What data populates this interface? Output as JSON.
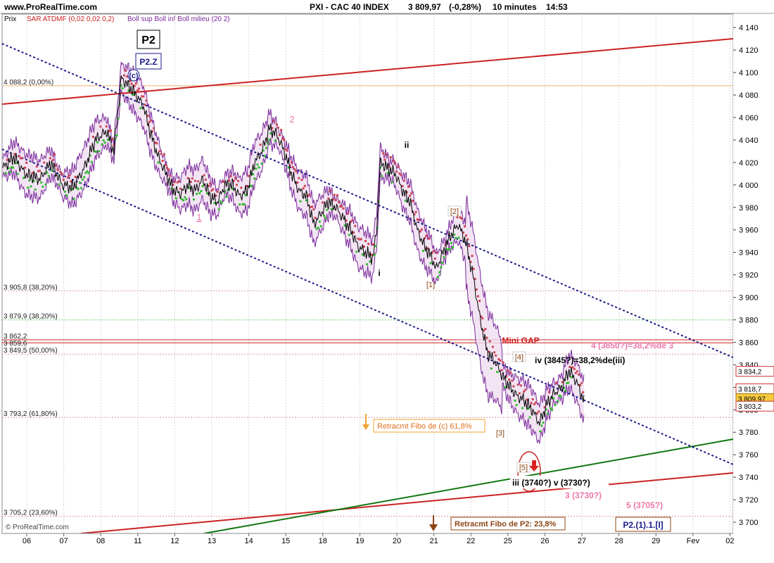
{
  "header": {
    "site": "www.ProRealTime.com",
    "title": "PXI - CAC 40 INDEX",
    "price": "3 809,97",
    "change": "(-0,28%)",
    "interval": "10 minutes",
    "time": "14:53"
  },
  "legend": {
    "prix": "Prix",
    "sar": "SAR ATDMF (0,02 0,02 0,2)",
    "boll": "Boll sup Boll inf Boll milieu (20 2)"
  },
  "watermark": "© ProRealTime.com",
  "colors": {
    "price": "#000000",
    "sar_up": "#33bb33",
    "sar_down": "#cc4455",
    "boll": "#7a2a9a",
    "boll_fill": "#f0ddf0",
    "trend_red": "#cc2222",
    "trend_green": "#117711",
    "channel": "#1a1a8a",
    "fibo": "#dd9999",
    "fibo_green": "#66cc66",
    "pink": "#ee77aa",
    "brown": "#8b4513",
    "axis_bg": "#eeeeee"
  },
  "chart_data": {
    "type": "line",
    "ylim": [
      3690,
      4152
    ],
    "y_ticks": [
      3700,
      3720,
      3740,
      3760,
      3780,
      3800,
      3820,
      3840,
      3860,
      3880,
      3900,
      3920,
      3940,
      3960,
      3980,
      4000,
      4020,
      4040,
      4060,
      4080,
      4100,
      4120,
      4140
    ],
    "y_tick_labels": [
      "3 700",
      "3 720",
      "3 740",
      "3 760",
      "3 780",
      "3 800",
      "3 820",
      "3 840",
      "3 860",
      "3 880",
      "3 900",
      "3 920",
      "3 940",
      "3 960",
      "3 980",
      "4 000",
      "4 020",
      "4 040",
      "4 060",
      "4 080",
      "4 100",
      "4 120",
      "4 140"
    ],
    "x_labels": [
      "06",
      "07",
      "08",
      "11",
      "12",
      "13",
      "14",
      "15",
      "18",
      "19",
      "20",
      "21",
      "22",
      "25",
      "26",
      "27",
      "28",
      "29",
      "Fev",
      "02"
    ],
    "price_path": [
      [
        0,
        4015
      ],
      [
        0.3,
        4025
      ],
      [
        0.6,
        4010
      ],
      [
        1.0,
        4005
      ],
      [
        1.3,
        4020
      ],
      [
        1.6,
        4000
      ],
      [
        1.9,
        3998
      ],
      [
        2.2,
        4015
      ],
      [
        2.5,
        4040
      ],
      [
        2.8,
        4048
      ],
      [
        3.0,
        4030
      ],
      [
        3.2,
        4095
      ],
      [
        3.4,
        4088
      ],
      [
        3.6,
        4080
      ],
      [
        3.8,
        4070
      ],
      [
        4.0,
        4045
      ],
      [
        4.2,
        4025
      ],
      [
        4.4,
        4010
      ],
      [
        4.6,
        3996
      ],
      [
        4.8,
        3992
      ],
      [
        5.0,
        4000
      ],
      [
        5.2,
        3995
      ],
      [
        5.4,
        4005
      ],
      [
        5.6,
        3990
      ],
      [
        5.8,
        3985
      ],
      [
        6.0,
        4000
      ],
      [
        6.2,
        4000
      ],
      [
        6.4,
        3990
      ],
      [
        6.6,
        3995
      ],
      [
        6.8,
        4020
      ],
      [
        7.0,
        4030
      ],
      [
        7.2,
        4050
      ],
      [
        7.4,
        4045
      ],
      [
        7.6,
        4030
      ],
      [
        7.8,
        4010
      ],
      [
        8.0,
        3995
      ],
      [
        8.2,
        3990
      ],
      [
        8.4,
        3965
      ],
      [
        8.6,
        3975
      ],
      [
        8.8,
        3985
      ],
      [
        9.0,
        3980
      ],
      [
        9.2,
        3970
      ],
      [
        9.4,
        3960
      ],
      [
        9.6,
        3945
      ],
      [
        9.8,
        3940
      ],
      [
        10.0,
        3935
      ],
      [
        10.1,
        3960
      ],
      [
        10.2,
        4020
      ],
      [
        10.4,
        4015
      ],
      [
        10.6,
        4010
      ],
      [
        10.8,
        3995
      ],
      [
        11.0,
        3985
      ],
      [
        11.2,
        3960
      ],
      [
        11.4,
        3945
      ],
      [
        11.6,
        3935
      ],
      [
        11.7,
        3925
      ],
      [
        11.9,
        3940
      ],
      [
        12.1,
        3955
      ],
      [
        12.3,
        3965
      ],
      [
        12.5,
        3950
      ],
      [
        12.7,
        3920
      ],
      [
        12.9,
        3880
      ],
      [
        13.1,
        3850
      ],
      [
        13.3,
        3843
      ],
      [
        13.5,
        3830
      ],
      [
        13.7,
        3820
      ],
      [
        13.9,
        3812
      ],
      [
        14.1,
        3808
      ],
      [
        14.3,
        3800
      ],
      [
        14.5,
        3788
      ],
      [
        14.7,
        3805
      ],
      [
        14.9,
        3815
      ],
      [
        15.1,
        3820
      ],
      [
        15.3,
        3835
      ],
      [
        15.5,
        3825
      ],
      [
        15.7,
        3808
      ]
    ]
  },
  "annotations": {
    "fibo_levels": [
      {
        "value": 4088.2,
        "label": "4 088,2 (0,00%)"
      },
      {
        "value": 3905.8,
        "label": "3 905,8 (38,20%)"
      },
      {
        "value": 3879.9,
        "label": "3 879,9 (38,20%)"
      },
      {
        "value": 3862.2,
        "label": "3 862,2"
      },
      {
        "value": 3859.6,
        "label": "3 859,6"
      },
      {
        "value": 3849.5,
        "label": "3 849,5 (50,00%)"
      },
      {
        "value": 3793.2,
        "label": "3 793,2 (61,80%)"
      },
      {
        "value": 3705.2,
        "label": "3 705,2 (23,60%)"
      }
    ],
    "price_boxes": [
      {
        "value": 3834.2,
        "label": "3 834,2",
        "type": "outline"
      },
      {
        "value": 3818.7,
        "label": "3 818,7",
        "type": "outline"
      },
      {
        "value": 3809.97,
        "label": "3 809,97",
        "type": "current"
      },
      {
        "value": 3803.2,
        "label": "3 803,2",
        "type": "outline"
      }
    ],
    "wave_labels": {
      "p2": "P2",
      "p2z": "P2.Z",
      "c": "(c)",
      "w1": "1",
      "w2": "2",
      "wi": "i",
      "wii": "ii",
      "b1": "[1]",
      "b2": "[2]",
      "b3": "[3]",
      "b4": "[4]",
      "b5": "[5]",
      "mini_gap": "Mini GAP",
      "iv_target": "iv (3845?)=38,2%de(iii)",
      "four_target": "4 (3850?)=38,2%de 3",
      "iii_v": "iii (3740?)  v (3730?)",
      "three_target": "3 (3730?)",
      "five_target": "5 (3705?)",
      "retr_c": "Retracmt Fibo de (c) 61,8%",
      "retr_p2": "Retracmt Fibo de P2: 23,8%",
      "p2_count": "P2.(1).1.[I]"
    }
  }
}
